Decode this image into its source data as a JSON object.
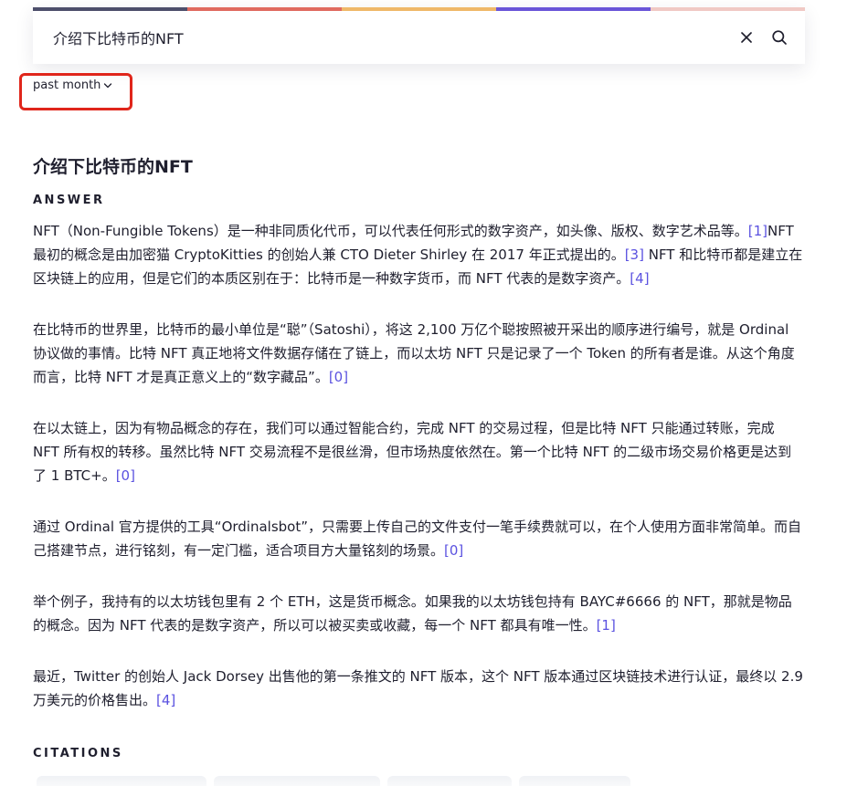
{
  "search": {
    "value": "介绍下比特币的NFT",
    "strip_colors": [
      "#4d4f6b",
      "#e06a5f",
      "#efb869",
      "#6a55d8",
      "#f0c9c4"
    ],
    "clear_icon": "close-icon",
    "search_icon": "search-icon"
  },
  "filter": {
    "label": "past month",
    "icon": "chevron-down-icon",
    "highlight_color": "#e0261b"
  },
  "title": "介绍下比特币的NFT",
  "answer_label": "ANSWER",
  "paragraphs": [
    {
      "segments": [
        {
          "text": "NFT（Non-Fungible Tokens）是一种非同质化代币，可以代表任何形式的数字资产，如头像、版权、数字艺术品等。"
        },
        {
          "text": "[1]",
          "cite": true
        },
        {
          "text": "NFT 最初的概念是由加密猫 CryptoKitties 的创始人兼 CTO Dieter Shirley 在 2017 年正式提出的。"
        },
        {
          "text": "[3]",
          "cite": true
        },
        {
          "text": " NFT 和比特币都是建立在区块链上的应用，但是它们的本质区别在于：比特币是一种数字货币，而 NFT 代表的是数字资产。"
        },
        {
          "text": "[4]",
          "cite": true
        }
      ]
    },
    {
      "segments": [
        {
          "text": "在比特币的世界里，比特币的最小单位是“聪”（Satoshi），将这 2,100 万亿个聪按照被开采出的顺序进行编号，就是 Ordinal 协议做的事情。比特 NFT 真正地将文件数据存储在了链上，而以太坊 NFT 只是记录了一个 Token 的所有者是谁。从这个角度而言，比特 NFT 才是真正意义上的“数字藏品”。"
        },
        {
          "text": "[0]",
          "cite": true
        }
      ]
    },
    {
      "segments": [
        {
          "text": "在以太链上，因为有物品概念的存在，我们可以通过智能合约，完成 NFT 的交易过程，但是比特 NFT 只能通过转账，完成 NFT 所有权的转移。虽然比特 NFT 交易流程不是很丝滑，但市场热度依然在。第一个比特 NFT 的二级市场交易价格更是达到了 1 BTC+。"
        },
        {
          "text": "[0]",
          "cite": true
        }
      ]
    },
    {
      "segments": [
        {
          "text": "通过 Ordinal 官方提供的工具“Ordinalsbot”，只需要上传自己的文件支付一笔手续费就可以，在个人使用方面非常简单。而自己搭建节点，进行铭刻，有一定门槛，适合项目方大量铭刻的场景。"
        },
        {
          "text": "[0]",
          "cite": true
        }
      ]
    },
    {
      "segments": [
        {
          "text": "举个例子，我持有的以太坊钱包里有 2 个 ETH，这是货币概念。如果我的以太坊钱包持有 BAYC#6666 的 NFT，那就是物品的概念。因为 NFT 代表的是数字资产，所以可以被买卖或收藏，每一个 NFT 都具有唯一性。"
        },
        {
          "text": "[1]",
          "cite": true
        }
      ]
    },
    {
      "segments": [
        {
          "text": "最近，Twitter 的创始人 Jack Dorsey 出售他的第一条推文的 NFT 版本，这个 NFT 版本通过区块链技术进行认证，最终以 2.9 万美元的价格售出。"
        },
        {
          "text": "[4]",
          "cite": true
        }
      ]
    }
  ],
  "citations_label": "CITATIONS",
  "citation_count": 4,
  "colors": {
    "text": "#1f1f2e",
    "citation_link": "#5b52e0"
  }
}
